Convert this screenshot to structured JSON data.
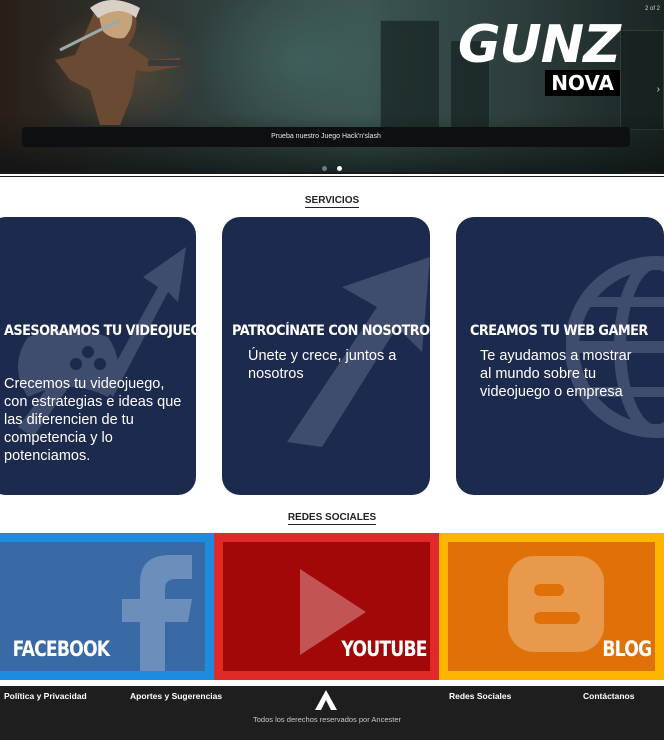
{
  "hero": {
    "logo_main": "GUNZ",
    "logo_sub": "NOVA",
    "counter": "2 of 2",
    "caption": "Prueba nuestro Juego Hack'n'slash",
    "next_arrow": "›"
  },
  "services": {
    "title": "SERVICIOS",
    "cards": [
      {
        "title": "ASESORAMOS TU VIDEOJUEGO",
        "text": "Crecemos tu videojuego, con estrategias e ideas que las diferencien de tu competencia y lo potenciamos.",
        "icon": "growth-chart-gamepad-icon"
      },
      {
        "title": "PATROCÍNATE CON NOSOTROS",
        "text": "Únete y crece, juntos a nosotros",
        "icon": "arrow-icon"
      },
      {
        "title": "CREAMOS TU WEB GAMER",
        "text": "Te ayudamos a mostrar al mundo sobre tu videojuego o empresa",
        "icon": "globe-icon"
      }
    ]
  },
  "social": {
    "title": "REDES SOCIALES",
    "items": [
      {
        "label": "FACEBOOK",
        "icon": "facebook-icon",
        "outer": "#1d8be0",
        "inner": "#3a6aa5"
      },
      {
        "label": "YOUTUBE",
        "icon": "youtube-play-icon",
        "outer": "#e02a28",
        "inner": "#a30808"
      },
      {
        "label": "BLOG",
        "icon": "blogger-icon",
        "outer": "#fdb500",
        "inner": "#e07008"
      }
    ]
  },
  "footer": {
    "links": [
      "Política y Privacidad",
      "Aportes y Sugerencias",
      "Redes Sociales",
      "Contáctanos"
    ],
    "copyright": "Todos los derechos reservados por Ancester",
    "logo_icon": "ancester-logo-icon"
  },
  "colors": {
    "card_bg": "#1c2a4e",
    "footer_bg": "#1e1e1e"
  }
}
